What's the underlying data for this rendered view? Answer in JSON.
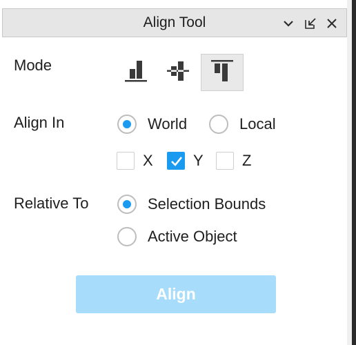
{
  "window": {
    "title": "Align Tool",
    "icons": [
      "chevron-down-icon",
      "dock-icon",
      "close-icon"
    ]
  },
  "mode": {
    "label": "Mode",
    "options": [
      {
        "icon": "align-bottom-icon",
        "selected": false
      },
      {
        "icon": "align-center-icon",
        "selected": false
      },
      {
        "icon": "align-top-icon",
        "selected": true
      }
    ]
  },
  "align_in": {
    "label": "Align In",
    "options": [
      {
        "label": "World",
        "checked": true
      },
      {
        "label": "Local",
        "checked": false
      }
    ],
    "axes": [
      {
        "label": "X",
        "checked": false
      },
      {
        "label": "Y",
        "checked": true
      },
      {
        "label": "Z",
        "checked": false
      }
    ]
  },
  "relative_to": {
    "label": "Relative To",
    "options": [
      {
        "label": "Selection Bounds",
        "checked": true
      },
      {
        "label": "Active Object",
        "checked": false
      }
    ]
  },
  "action": {
    "label": "Align",
    "enabled": false
  },
  "colors": {
    "accent": "#1a9bf0",
    "button_disabled": "#a8dcfb",
    "icon": "#3a3a3a"
  }
}
